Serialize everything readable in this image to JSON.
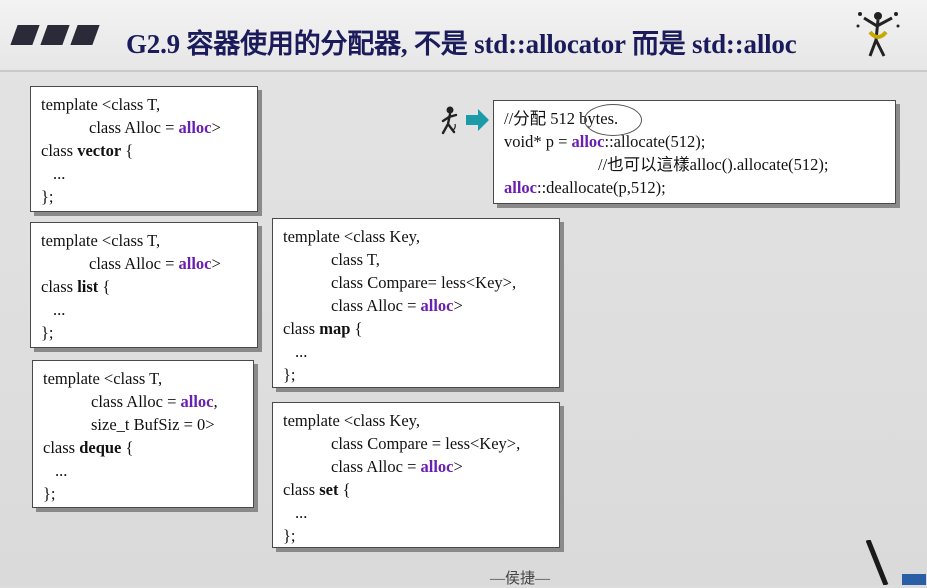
{
  "slide": {
    "title": "G2.9 容器使用的分配器, 不是 std::allocator 而是 std::alloc",
    "footer": "—侯捷—"
  },
  "boxes": {
    "vector": [
      "template <class T,",
      "class Alloc = ",
      "alloc",
      ">",
      "class ",
      "vector",
      " {",
      "...",
      "};"
    ],
    "list": [
      "template <class T,",
      "class Alloc = ",
      "alloc",
      ">",
      "class ",
      "list",
      " {",
      "...",
      "};"
    ],
    "deque": [
      "template <class T,",
      "class Alloc = ",
      "alloc",
      ",",
      "size_t BufSiz = 0>",
      "class ",
      "deque",
      " {",
      "...",
      "};"
    ],
    "map": [
      "template <class Key,",
      "class T,",
      "class Compare= less<Key>,",
      "class Alloc = ",
      "alloc",
      ">",
      "class ",
      "map",
      " {",
      "...",
      "};"
    ],
    "set": [
      "template <class Key,",
      "class Compare = less<Key>,",
      "class Alloc = ",
      "alloc",
      ">",
      "class ",
      "set",
      " {",
      "...",
      "};"
    ],
    "example": [
      "//分配 512 bytes.",
      "void* p = ",
      "alloc",
      "::allocate(512);",
      "//也可以這樣alloc().allocate(512);",
      "alloc",
      "::deallocate(p,512);"
    ]
  },
  "icons": {
    "logo": "juggler-logo-icon",
    "runner": "running-man-icon",
    "arrow": "right-arrow-icon",
    "pen": "stylus-pen-icon"
  },
  "colors": {
    "title": "#1b1b5c",
    "keyword": "#6a1fb0",
    "arrow": "#1b9aa8"
  }
}
